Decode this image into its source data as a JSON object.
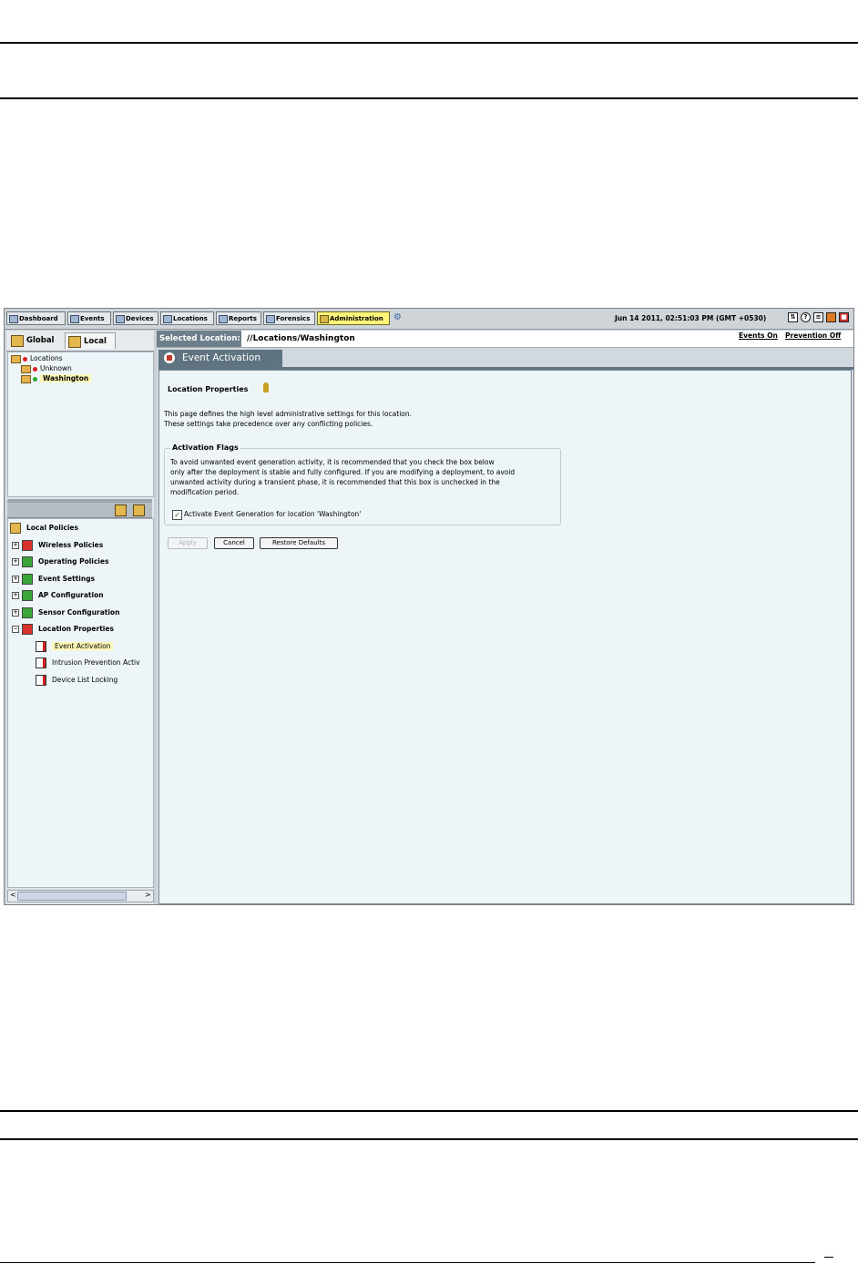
{
  "toolbar": {
    "buttons": [
      {
        "label": "Dashboard",
        "active": false
      },
      {
        "label": "Events",
        "active": false
      },
      {
        "label": "Devices",
        "active": false
      },
      {
        "label": "Locations",
        "active": false
      },
      {
        "label": "Reports",
        "active": false
      },
      {
        "label": "Forensics",
        "active": false
      },
      {
        "label": "Administration",
        "active": true
      }
    ],
    "datetime": "Jun 14 2011, 02:51:03 PM (GMT +0530)",
    "header_icons": [
      "sync-icon",
      "help-icon",
      "list-icon",
      "shield-icon",
      "exit-icon"
    ]
  },
  "left_panel": {
    "tabs": {
      "global": "Global",
      "local": "Local",
      "selected": "Local"
    },
    "location_tree": [
      {
        "label": "Locations",
        "status": "red"
      },
      {
        "label": "Unknown",
        "status": "red"
      },
      {
        "label": "Washington",
        "status": "green",
        "selected": true
      }
    ],
    "policies_root": "Local Policies",
    "policies": [
      {
        "label": "Wireless Policies",
        "icon": "red"
      },
      {
        "label": "Operating Policies",
        "icon": "green"
      },
      {
        "label": "Event Settings",
        "icon": "green"
      },
      {
        "label": "AP Configuration",
        "icon": "green"
      },
      {
        "label": "Sensor Configuration",
        "icon": "green"
      },
      {
        "label": "Location Properties",
        "icon": "red",
        "expanded": true
      }
    ],
    "location_properties_children": [
      {
        "label": "Event Activation",
        "selected": true
      },
      {
        "label": "Intrusion Prevention Activ"
      },
      {
        "label": "Device List Locking"
      }
    ]
  },
  "right_panel": {
    "selected_location_label": "Selected Location:",
    "selected_location_path": "//Locations/Washington",
    "links": {
      "events_on": "Events On",
      "prevention_off": "Prevention Off"
    },
    "page_tab": "Event Activation",
    "section_title": "Location Properties",
    "description": [
      "This page defines the high level administrative settings for this location.",
      "These settings take precedence over any conflicting policies."
    ],
    "activation_flags": {
      "legend": "Activation Flags",
      "text": [
        "To avoid unwanted event generation activity, it is recommended that you check the box below",
        "only after the deployment is stable and fully configured. If you are modifying a deployment, to avoid",
        "unwanted activity during a transient phase, it is recommended that this box is unchecked in the",
        "modification period."
      ],
      "checkbox_label": "Activate Event Generation for location 'Washington'",
      "checked": true
    },
    "buttons": {
      "apply": "Apply",
      "cancel": "Cancel",
      "restore": "Restore Defaults"
    }
  }
}
